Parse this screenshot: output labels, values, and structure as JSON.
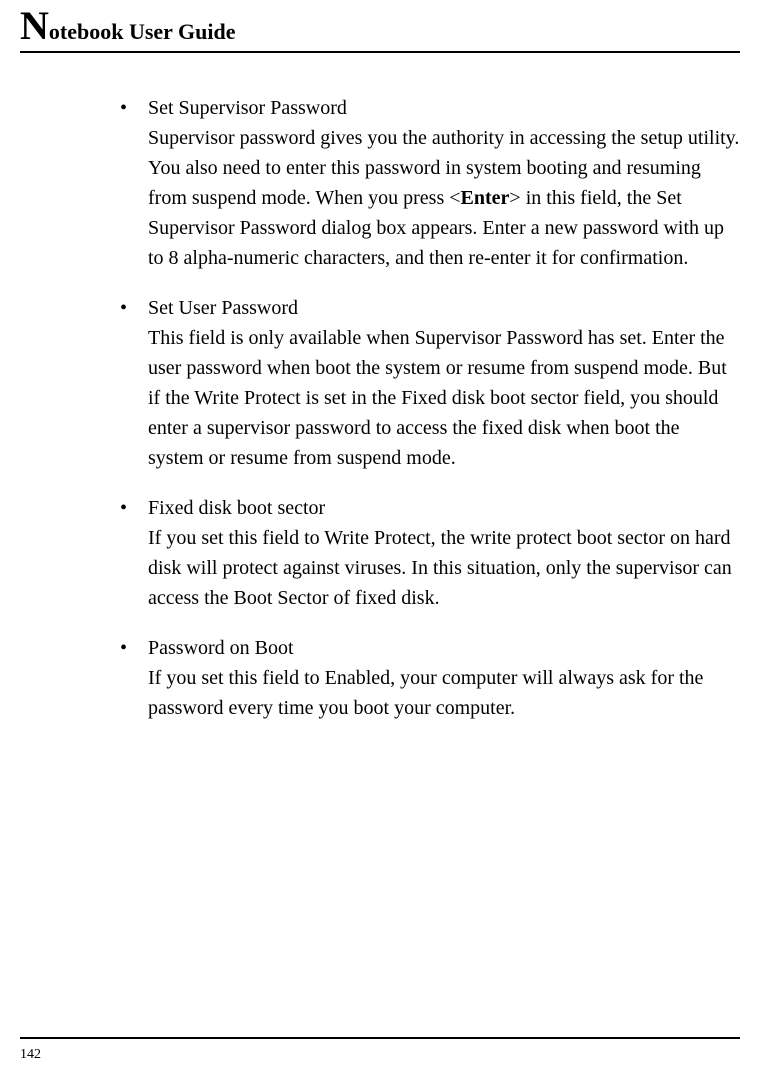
{
  "header": {
    "drop_cap": "N",
    "title_rest": "otebook User Guide"
  },
  "items": [
    {
      "title": "Set Supervisor Password",
      "body_pre": "Supervisor password gives you the authority in accessing the setup utility. You also need to enter this password in system booting and resuming from suspend mode. When you press <",
      "body_bold": "Enter",
      "body_post": "> in this field, the Set Supervisor Password dialog box appears. Enter a new password with up to 8 alpha-numeric characters, and then re-enter it for confirmation."
    },
    {
      "title": "Set User Password",
      "body": "This field is only available when Supervisor Password has set. Enter the user password when boot the system or resume from suspend mode. But if the Write Protect is set in the Fixed disk boot sector field, you should enter a supervisor password to access the fixed disk when boot the system or resume from suspend mode."
    },
    {
      "title": "Fixed disk boot sector",
      "body": "If you set this field to Write Protect, the write protect boot sector on hard disk will protect against viruses. In this situation, only the supervisor can access the Boot Sector of fixed disk."
    },
    {
      "title": "Password on Boot",
      "body": "If you set this field to Enabled, your computer will always ask for the password every time you boot your computer."
    }
  ],
  "footer": {
    "page_number": "142"
  }
}
